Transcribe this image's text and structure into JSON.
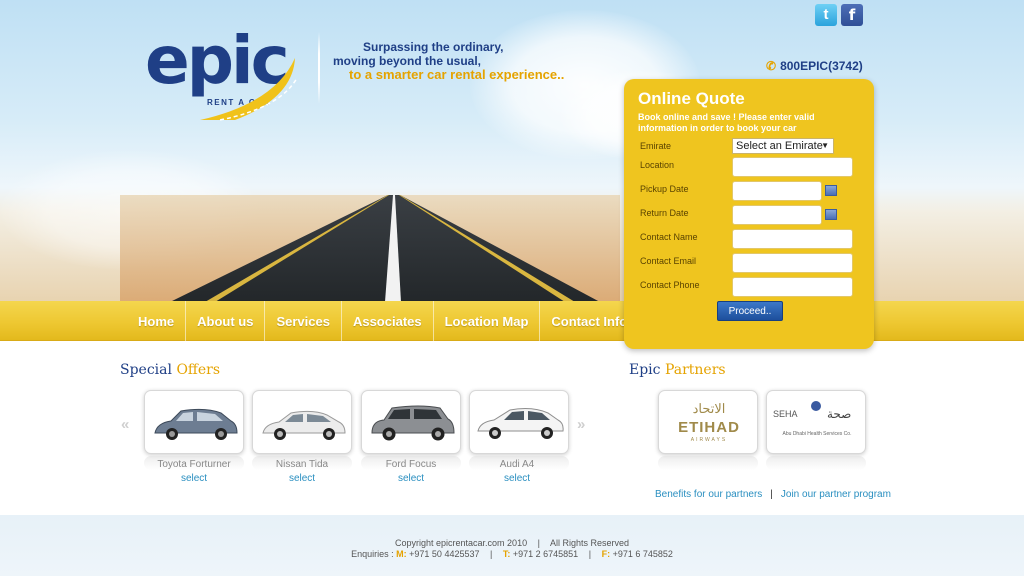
{
  "brand": {
    "logo_text": "epic",
    "logo_sub": "RENT A CAR",
    "tagline_1": "Surpassing the ordinary,",
    "tagline_2": "moving beyond the usual,",
    "tagline_3": "to a smarter car rental experience.."
  },
  "header": {
    "phone": "800EPIC(3742)",
    "social": {
      "twitter_glyph": "t",
      "facebook_glyph": "f"
    }
  },
  "nav": {
    "items": [
      "Home",
      "About us",
      "Services",
      "Associates",
      "Location Map",
      "Contact Info"
    ]
  },
  "quote": {
    "title": "Online Quote",
    "description": "Book online and save ! Please enter valid information in order to book your car",
    "emirate_label": "Emirate",
    "emirate_selected": "Select an Emirate",
    "location_label": "Location",
    "pickup_label": "Pickup Date",
    "return_label": "Return Date",
    "contact_name_label": "Contact Name",
    "contact_email_label": "Contact Email",
    "contact_phone_label": "Contact Phone",
    "proceed_label": "Proceed.."
  },
  "offers": {
    "title_a": "Special",
    "title_b": "Offers",
    "cars": [
      {
        "name": "Toyota Forturner",
        "action": "select",
        "color": "#6d7d92"
      },
      {
        "name": "Nissan Tida",
        "action": "select",
        "color": "#e6e6e6"
      },
      {
        "name": "Ford Focus",
        "action": "select",
        "color": "#8c8f93"
      },
      {
        "name": "Audi A4",
        "action": "select",
        "color": "#f2f2f2"
      }
    ]
  },
  "partners": {
    "title_a": "Epic",
    "title_b": "Partners",
    "items": [
      {
        "logo_text": "ETIHAD",
        "logo_arabic": "الاتحاد",
        "logo_sub": "AIRWAYS"
      },
      {
        "logo_text": "SEHA",
        "logo_arabic": "صحة",
        "logo_sub": "Abu Dhabi Health Services Co."
      }
    ],
    "link_benefits": "Benefits for our partners",
    "link_separator": "|",
    "link_join": "Join our partner program"
  },
  "footer": {
    "copyright": "Copyright epicrentacar.com 2010",
    "rights": "All Rights Reserved",
    "enquiries_label": "Enquiries :",
    "m_key": "M:",
    "m_value": "+971 50 4425537",
    "t_key": "T:",
    "t_value": "+971 2 6745851",
    "f_key": "F:",
    "f_value": "+971 6 745852"
  },
  "colors": {
    "navy": "#1f3f86",
    "gold": "#efc51f",
    "accent": "#e5a300",
    "link": "#2a8fc0"
  }
}
